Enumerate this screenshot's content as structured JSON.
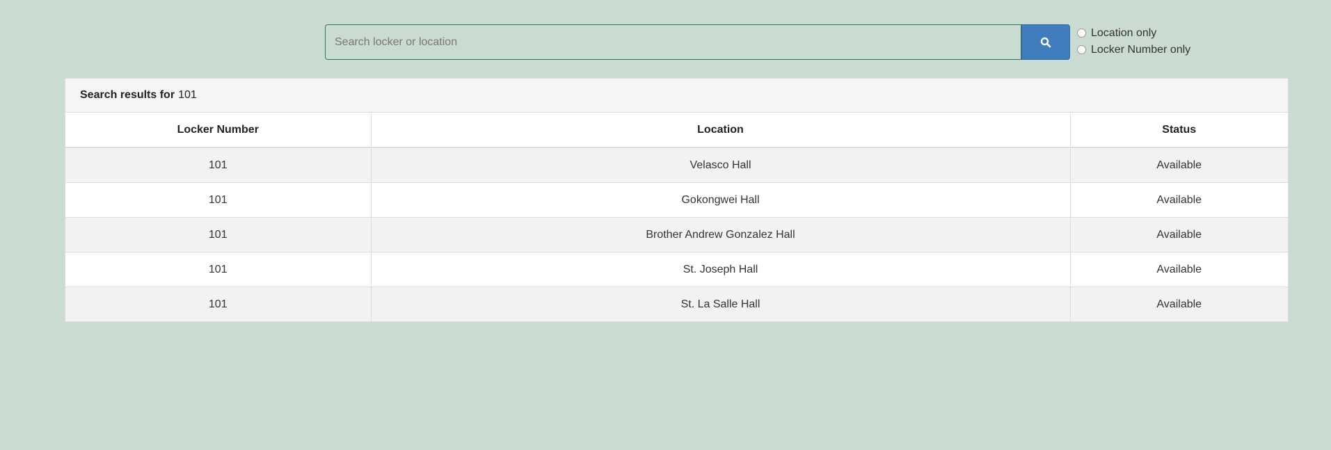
{
  "search": {
    "placeholder": "Search locker or location",
    "value": "",
    "button_icon": "search-icon",
    "button_color": "#3f7dbd",
    "options": [
      {
        "label": "Location only",
        "selected": false
      },
      {
        "label": "Locker Number only",
        "selected": false
      }
    ]
  },
  "results": {
    "heading_label": "Search results for",
    "query": "101",
    "columns": [
      "Locker Number",
      "Location",
      "Status"
    ],
    "rows": [
      [
        "101",
        "Velasco Hall",
        "Available"
      ],
      [
        "101",
        "Gokongwei Hall",
        "Available"
      ],
      [
        "101",
        "Brother Andrew Gonzalez Hall",
        "Available"
      ],
      [
        "101",
        "St. Joseph Hall",
        "Available"
      ],
      [
        "101",
        "St. La Salle Hall",
        "Available"
      ]
    ]
  },
  "colors": {
    "background": "#cadbd1",
    "input_border": "#2e7d4a"
  }
}
